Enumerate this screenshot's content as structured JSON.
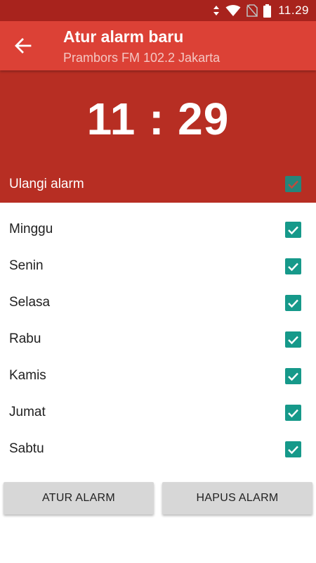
{
  "status_bar": {
    "time": "11.29",
    "icons": [
      "data-transfer-icon",
      "wifi-icon",
      "no-sim-icon",
      "battery-icon"
    ]
  },
  "app_bar": {
    "title": "Atur alarm baru",
    "subtitle": "Prambors FM 102.2 Jakarta",
    "back_icon": "arrow-left-icon"
  },
  "alarm": {
    "time": "11 : 29",
    "repeat_label": "Ulangi alarm",
    "repeat_checked": true
  },
  "days": [
    {
      "label": "Minggu",
      "checked": true
    },
    {
      "label": "Senin",
      "checked": true
    },
    {
      "label": "Selasa",
      "checked": true
    },
    {
      "label": "Rabu",
      "checked": true
    },
    {
      "label": "Kamis",
      "checked": true
    },
    {
      "label": "Jumat",
      "checked": true
    },
    {
      "label": "Sabtu",
      "checked": true
    }
  ],
  "buttons": {
    "set_alarm": "ATUR ALARM",
    "delete_alarm": "HAPUS ALARM"
  },
  "colors": {
    "status_bar": "#a8231d",
    "app_bar": "#dc4136",
    "header_panel": "#b72e23",
    "checkbox": "#16998a",
    "button": "#d7d7d7"
  }
}
